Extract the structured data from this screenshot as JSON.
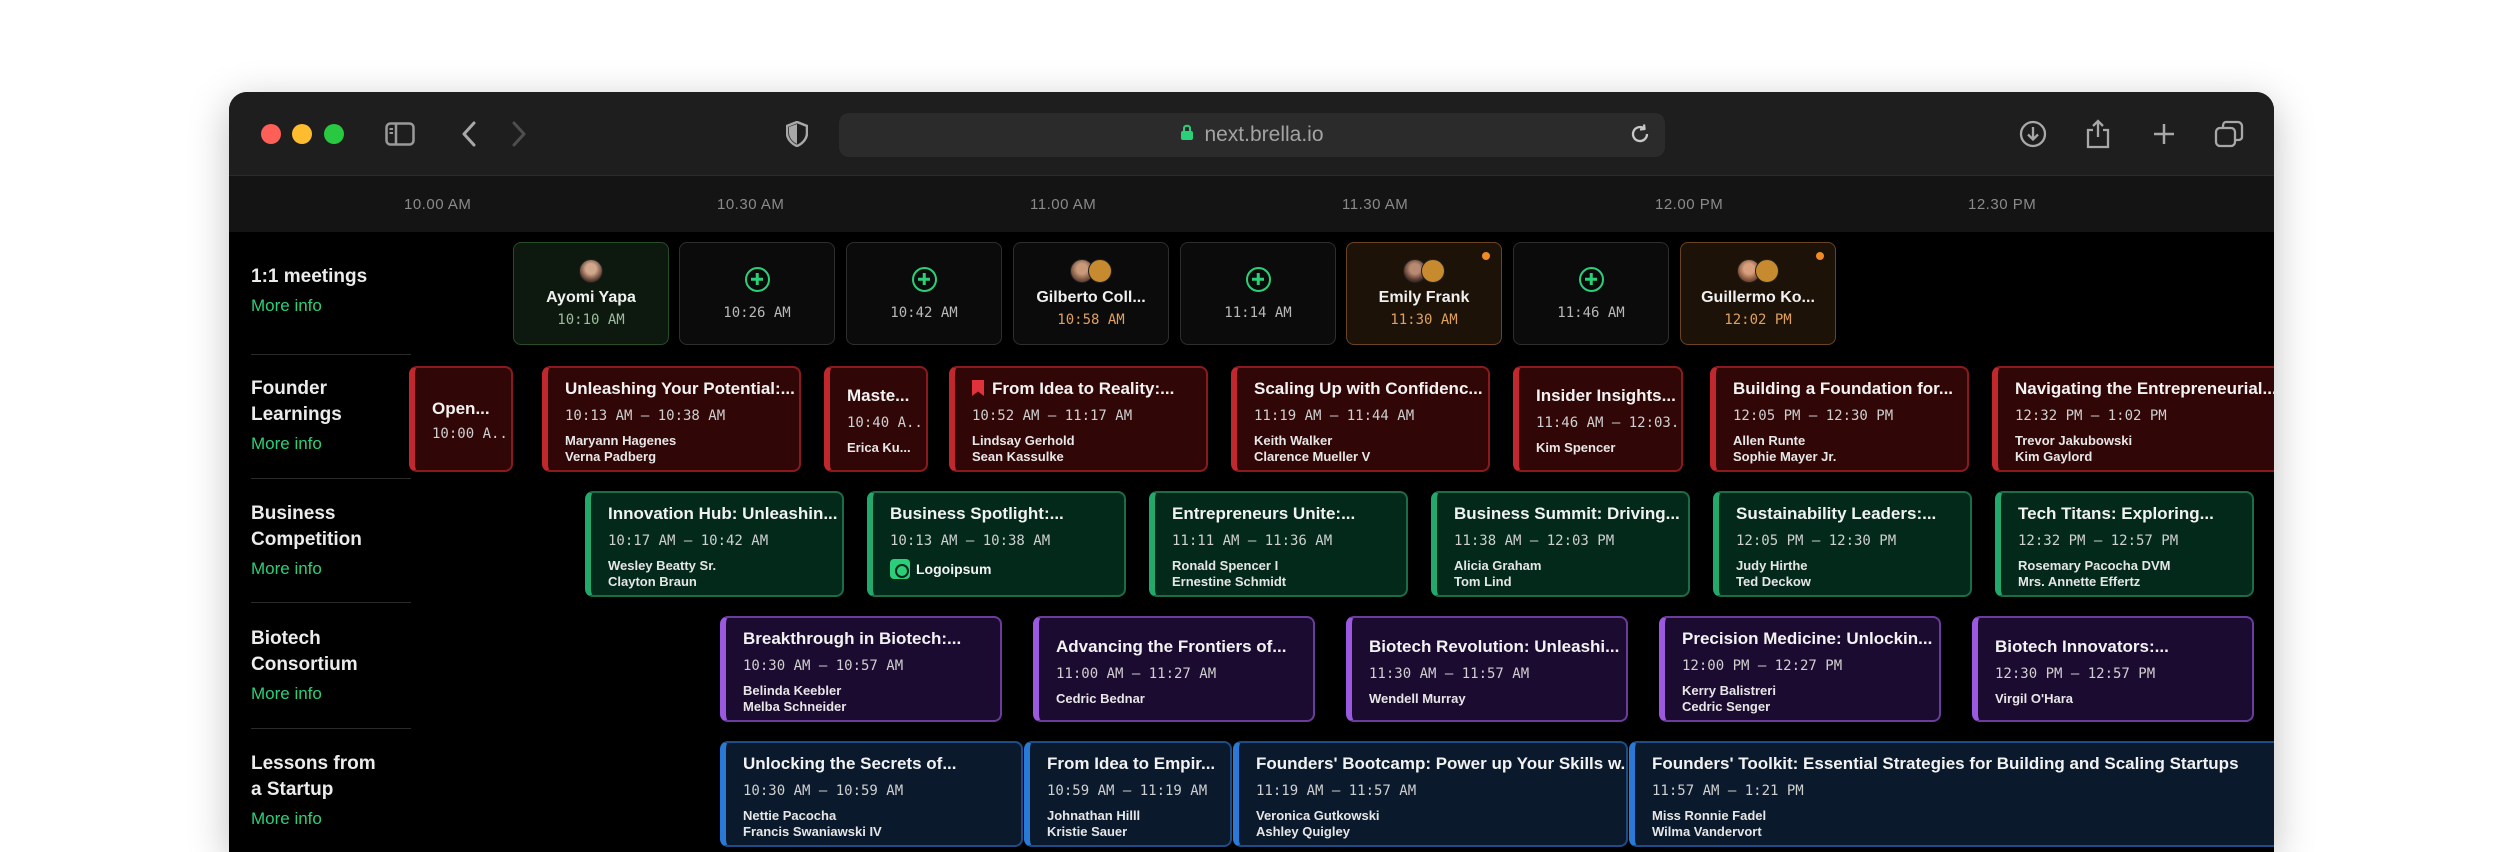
{
  "browser": {
    "url": "next.brella.io"
  },
  "colors": {
    "accent": "#2ccf79",
    "red": "#c0282e",
    "green": "#23a96c",
    "purple": "#9b59e0",
    "blue": "#2a79d6",
    "orange": "#f08a24"
  },
  "timeline": {
    "ticks": [
      "10.00 AM",
      "10.30 AM",
      "11.00 AM",
      "11.30 AM",
      "12.00 PM",
      "12.30 PM"
    ]
  },
  "rows": [
    {
      "name": "1:1 meetings",
      "more": "More info"
    },
    {
      "name": "Founder Learnings",
      "more": "More info"
    },
    {
      "name": "Business Competition",
      "more": "More info"
    },
    {
      "name": "Biotech Consortium",
      "more": "More info"
    },
    {
      "name": "Lessons from a Startup",
      "more": "More info"
    }
  ],
  "meetings": [
    {
      "name": "Ayomi Yapa",
      "time": "10:10 AM"
    },
    {
      "name": "",
      "time": "10:26 AM"
    },
    {
      "name": "",
      "time": "10:42 AM"
    },
    {
      "name": "Gilberto Coll...",
      "time": "10:58 AM"
    },
    {
      "name": "",
      "time": "11:14 AM"
    },
    {
      "name": "Emily Frank",
      "time": "11:30 AM"
    },
    {
      "name": "",
      "time": "11:46 AM"
    },
    {
      "name": "Guillermo Ko...",
      "time": "12:02 PM"
    }
  ],
  "founder": [
    {
      "title": "Open...",
      "time": "10:00 A...",
      "people": []
    },
    {
      "title": "Unleashing Your Potential:...",
      "time": "10:13 AM – 10:38 AM",
      "people": [
        "Maryann Hagenes",
        "Verna Padberg"
      ]
    },
    {
      "title": "Maste...",
      "time": "10:40 A...",
      "people": [
        "Erica Ku..."
      ]
    },
    {
      "title": "From Idea to Reality:...",
      "time": "10:52 AM – 11:17 AM",
      "people": [
        "Lindsay Gerhold",
        "Sean Kassulke"
      ]
    },
    {
      "title": "Scaling Up with Confidenc...",
      "time": "11:19 AM – 11:44 AM",
      "people": [
        "Keith Walker",
        "Clarence Mueller V"
      ]
    },
    {
      "title": "Insider Insights...",
      "time": "11:46 AM – 12:03...",
      "people": [
        "Kim Spencer"
      ]
    },
    {
      "title": "Building a Foundation for...",
      "time": "12:05 PM – 12:30 PM",
      "people": [
        "Allen Runte",
        "Sophie Mayer Jr."
      ]
    },
    {
      "title": "Navigating the Entrepreneurial...",
      "time": "12:32 PM – 1:02 PM",
      "people": [
        "Trevor Jakubowski",
        "Kim Gaylord"
      ]
    }
  ],
  "business": [
    {
      "title": "Innovation Hub: Unleashin...",
      "time": "10:17 AM – 10:42 AM",
      "people": [
        "Wesley Beatty Sr.",
        "Clayton Braun"
      ]
    },
    {
      "title": "Business Spotlight:...",
      "time": "10:13 AM – 10:38 AM",
      "people": [],
      "logo": "Logoipsum"
    },
    {
      "title": "Entrepreneurs Unite:...",
      "time": "11:11 AM – 11:36 AM",
      "people": [
        "Ronald Spencer I",
        "Ernestine Schmidt"
      ]
    },
    {
      "title": "Business Summit: Driving...",
      "time": "11:38 AM – 12:03 PM",
      "people": [
        "Alicia Graham",
        "Tom Lind"
      ]
    },
    {
      "title": "Sustainability Leaders:...",
      "time": "12:05 PM – 12:30 PM",
      "people": [
        "Judy Hirthe",
        "Ted Deckow"
      ]
    },
    {
      "title": "Tech Titans: Exploring...",
      "time": "12:32 PM – 12:57 PM",
      "people": [
        "Rosemary Pacocha DVM",
        "Mrs. Annette Effertz"
      ]
    }
  ],
  "biotech": [
    {
      "title": "Breakthrough in Biotech:...",
      "time": "10:30 AM – 10:57 AM",
      "people": [
        "Belinda Keebler",
        "Melba Schneider"
      ]
    },
    {
      "title": "Advancing the Frontiers of...",
      "time": "11:00 AM – 11:27 AM",
      "people": [
        "Cedric Bednar"
      ]
    },
    {
      "title": "Biotech Revolution: Unleashi...",
      "time": "11:30 AM – 11:57 AM",
      "people": [
        "Wendell Murray"
      ]
    },
    {
      "title": "Precision Medicine: Unlockin...",
      "time": "12:00 PM – 12:27 PM",
      "people": [
        "Kerry Balistreri",
        "Cedric Senger"
      ]
    },
    {
      "title": "Biotech Innovators:...",
      "time": "12:30 PM – 12:57 PM",
      "people": [
        "Virgil O'Hara"
      ]
    }
  ],
  "lessons": [
    {
      "title": "Unlocking the Secrets of...",
      "time": "10:30 AM – 10:59 AM",
      "people": [
        "Nettie Pacocha",
        "Francis Swaniawski IV"
      ]
    },
    {
      "title": "From Idea to Empir...",
      "time": "10:59 AM – 11:19 AM",
      "people": [
        "Johnathan Hilll",
        "Kristie Sauer"
      ]
    },
    {
      "title": "Founders' Bootcamp: Power up Your Skills w...",
      "time": "11:19 AM – 11:57 AM",
      "people": [
        "Veronica Gutkowski",
        "Ashley Quigley"
      ]
    },
    {
      "title": "Founders' Toolkit: Essential Strategies for Building and Scaling Startups",
      "time": "11:57 AM – 1:21 PM",
      "people": [
        "Miss Ronnie Fadel",
        "Wilma Vandervort"
      ]
    }
  ]
}
